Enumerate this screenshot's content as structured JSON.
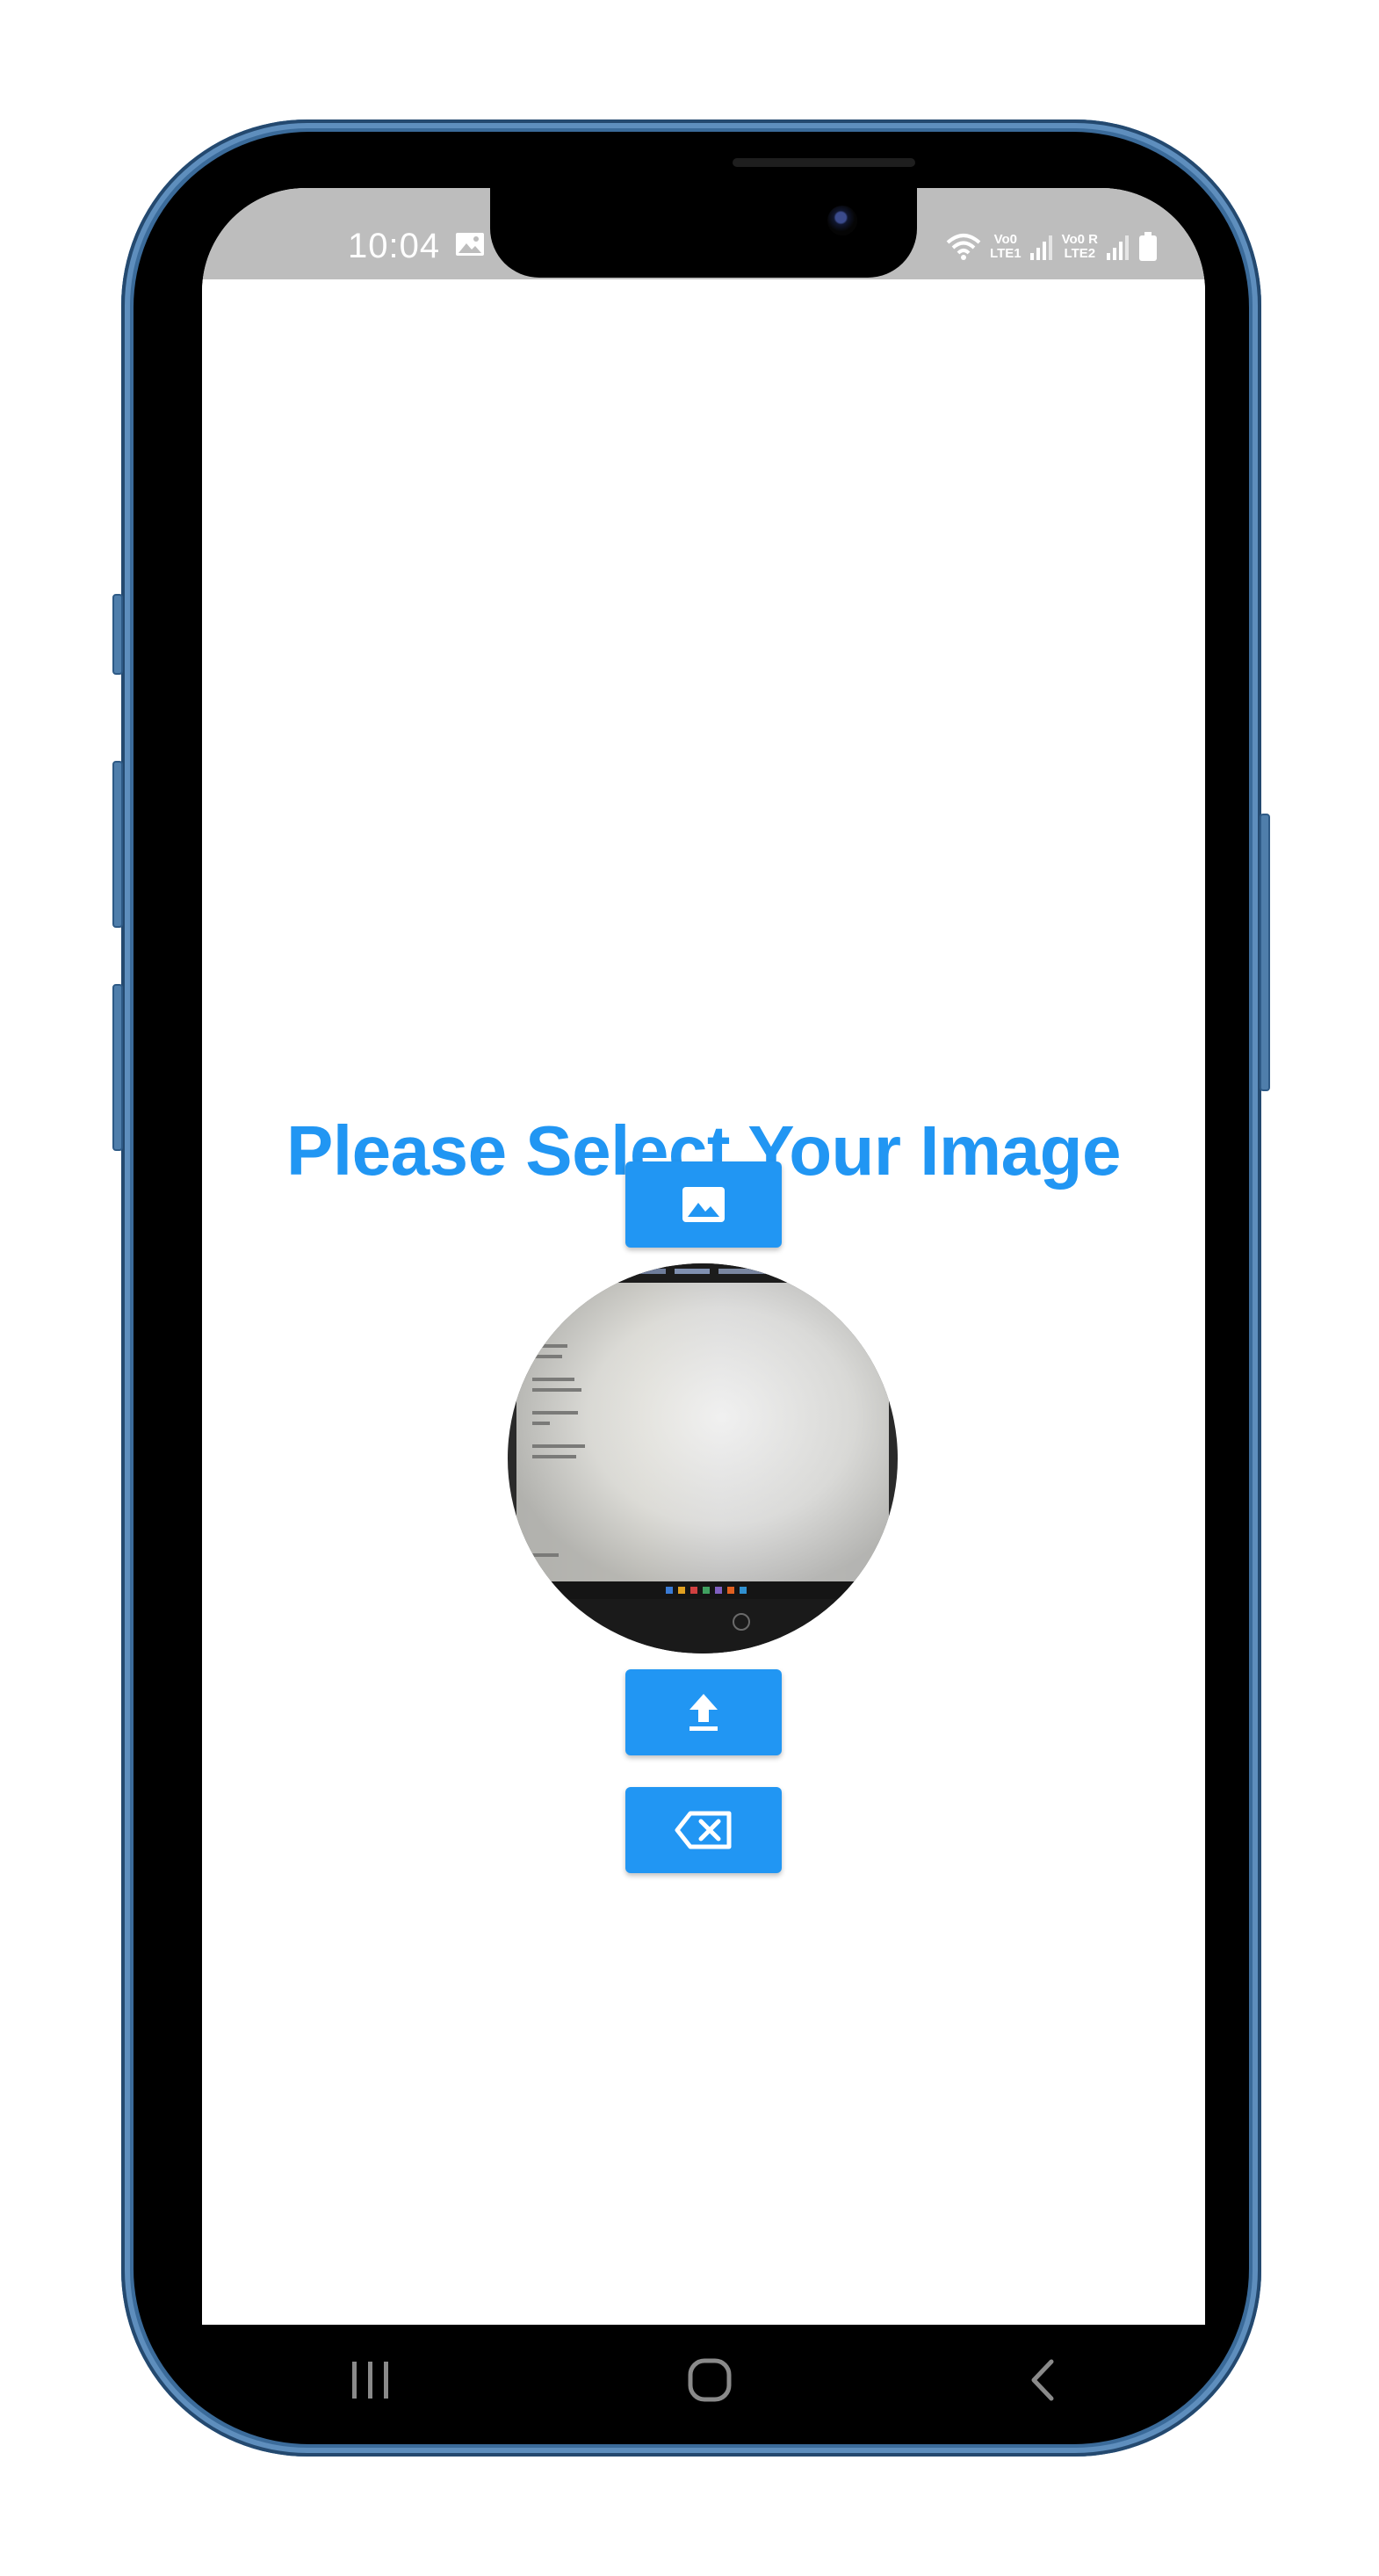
{
  "status_bar": {
    "time": "10:04",
    "sim1_label_top": "Vo0",
    "sim1_label_bottom": "LTE1",
    "sim2_label_top": "Vo0 R",
    "sim2_label_bottom": "LTE2"
  },
  "main": {
    "title": "Please Select Your Image",
    "buttons": {
      "select_image_icon": "image-icon",
      "upload_icon": "upload-icon",
      "clear_icon": "backspace-clear-icon"
    },
    "preview_icon": "selected-image-preview"
  },
  "nav_bar": {
    "recents_icon": "recents-icon",
    "home_icon": "home-icon",
    "back_icon": "back-icon"
  },
  "colors": {
    "accent": "#2196f3",
    "status_bar_bg": "#bdbdbd",
    "frame": "#3b6b9a",
    "screen_bg": "#ffffff"
  }
}
